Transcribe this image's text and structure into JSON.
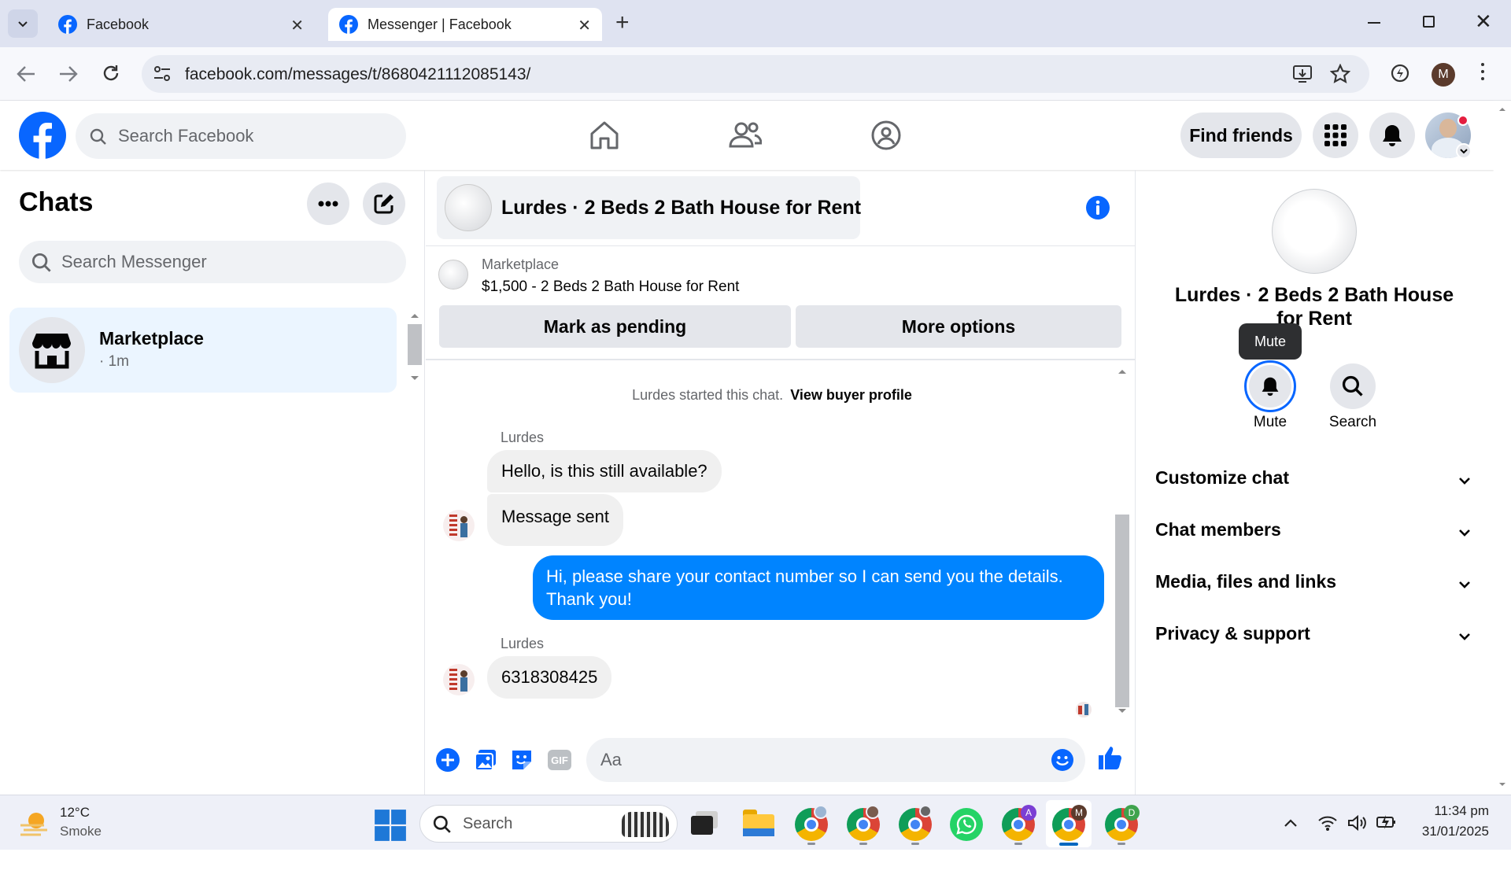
{
  "browser": {
    "tabs": [
      {
        "title": "Facebook",
        "active": false
      },
      {
        "title": "Messenger | Facebook",
        "active": true
      }
    ],
    "new_tab": "+",
    "url": "facebook.com/messages/t/8680421112085143/",
    "profile_initial": "M"
  },
  "facebook": {
    "search_placeholder": "Search Facebook",
    "find_friends": "Find friends"
  },
  "chats": {
    "title": "Chats",
    "search_placeholder": "Search Messenger",
    "items": [
      {
        "name": "Marketplace",
        "meta": "· 1m"
      }
    ]
  },
  "conversation": {
    "title": "Lurdes · 2 Beds 2 Bath House for Rent",
    "listing": {
      "source": "Marketplace",
      "summary": "$1,500 - 2 Beds 2 Bath House for Rent",
      "mark_pending": "Mark as pending",
      "more_options": "More options"
    },
    "started_text": "Lurdes started this chat.",
    "view_profile": "View buyer profile",
    "messages": [
      {
        "sender": "Lurdes",
        "text": "Hello, is this still available?"
      },
      {
        "sender": "",
        "text": "Message sent"
      },
      {
        "sender": "me",
        "text": "Hi, please share your contact number so I can send you the details. Thank you!"
      },
      {
        "sender": "Lurdes",
        "text": "6318308425"
      }
    ],
    "composer_placeholder": "Aa"
  },
  "info_panel": {
    "name": "Lurdes · 2 Beds 2 Bath House for Rent",
    "tooltip": "Mute",
    "actions": [
      {
        "label": "Mute"
      },
      {
        "label": "Search"
      }
    ],
    "sections": [
      "Customize chat",
      "Chat members",
      "Media, files and links",
      "Privacy & support"
    ]
  },
  "taskbar": {
    "weather_temp": "12°C",
    "weather_desc": "Smoke",
    "search_label": "Search",
    "time": "11:34 pm",
    "date": "31/01/2025"
  },
  "colors": {
    "fb_blue": "#0866ff",
    "messenger_blue": "#0084ff",
    "selected_chat": "#ebf5ff"
  }
}
